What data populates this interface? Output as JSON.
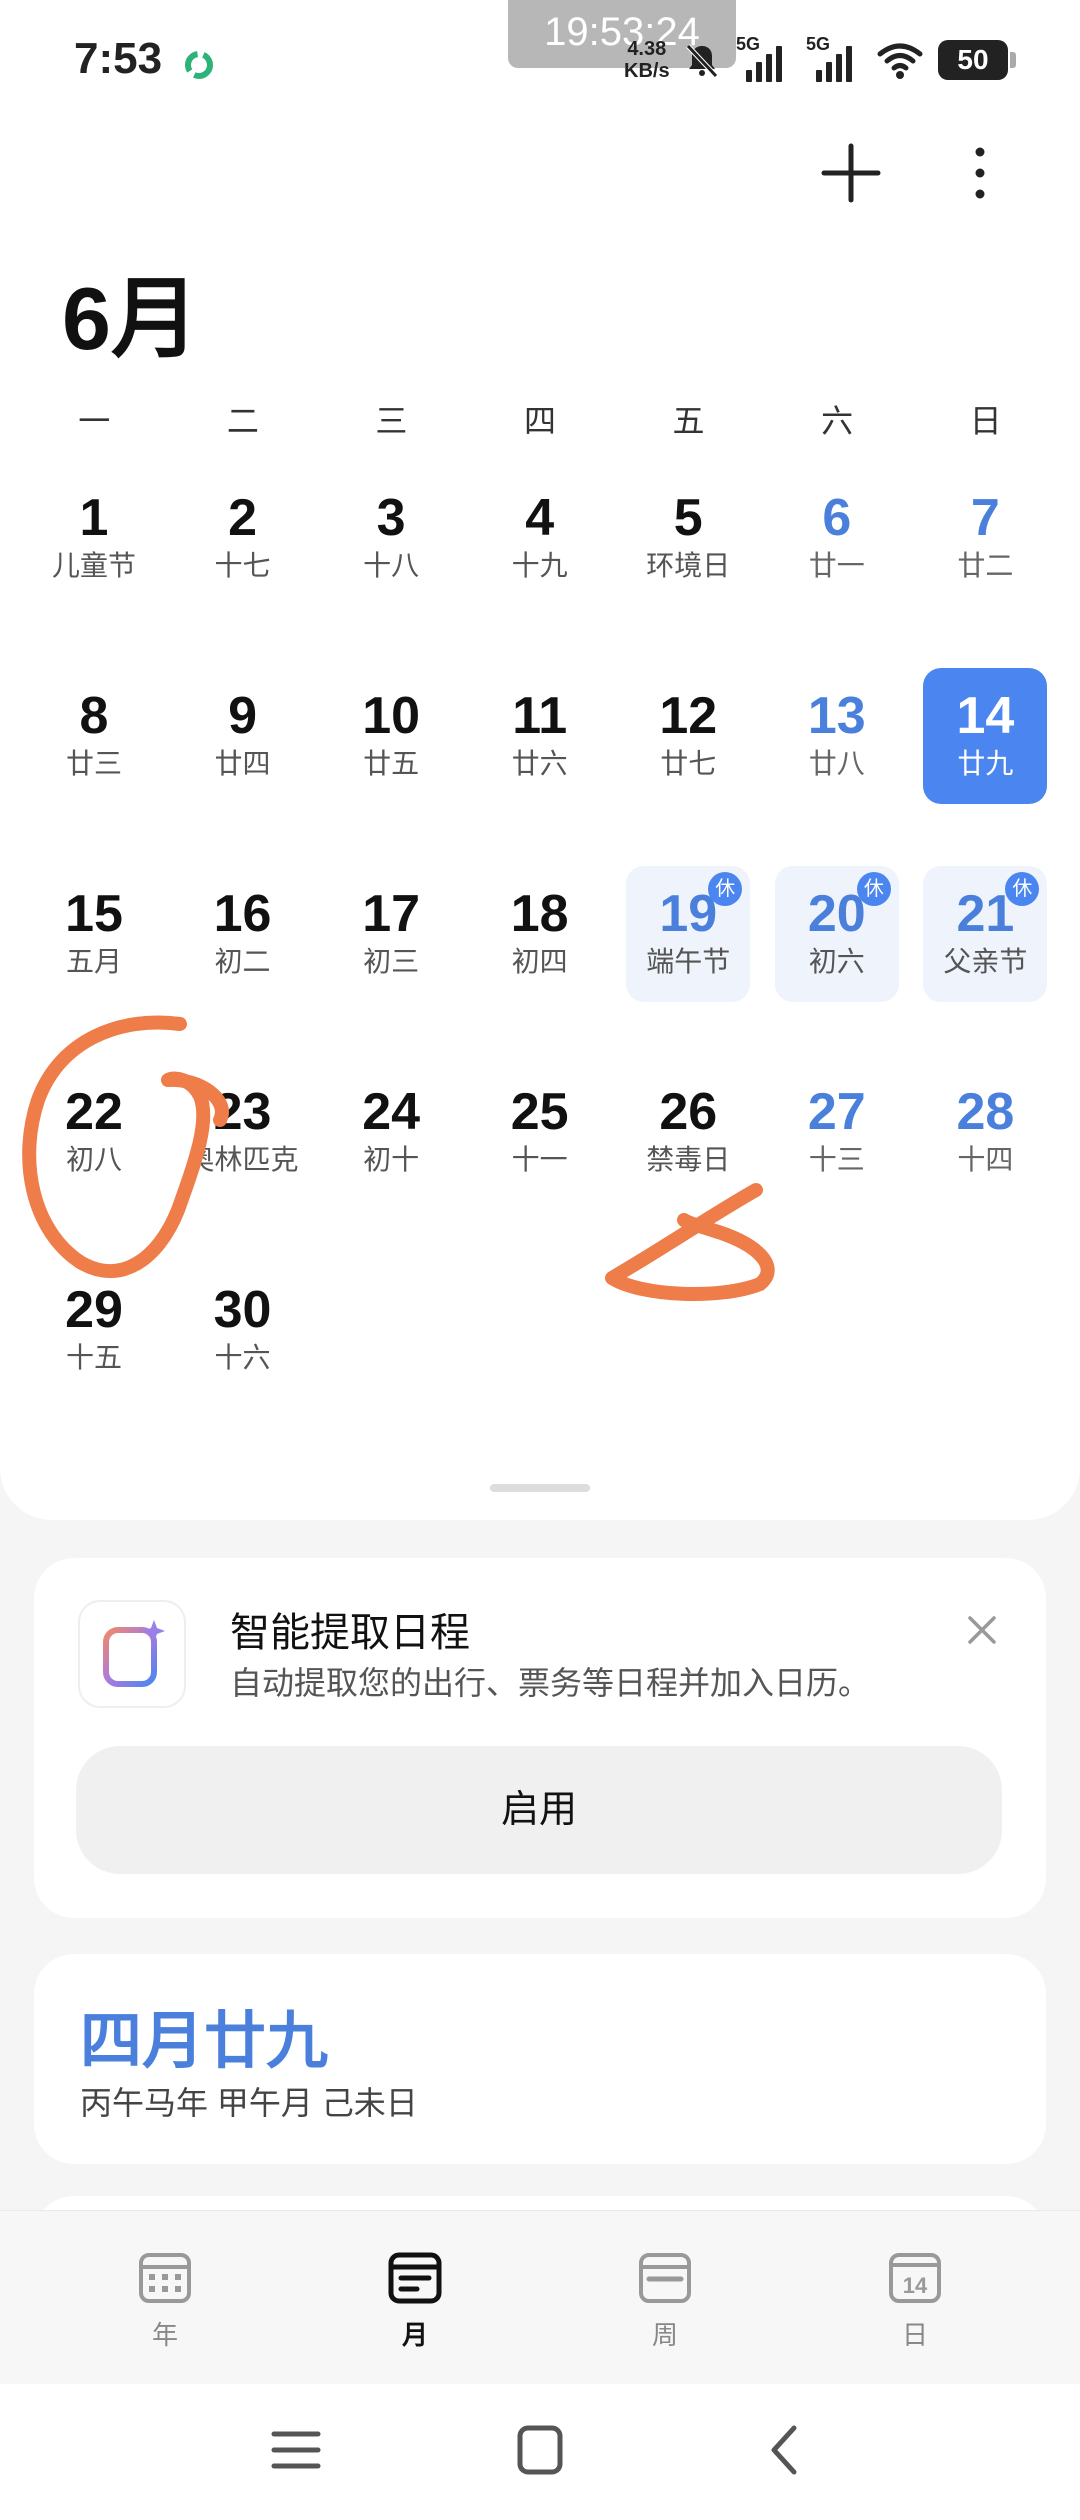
{
  "status_bar": {
    "time": "7:53",
    "overlay_clock": "19:53:24",
    "net_speed_value": "4.38",
    "net_speed_unit": "KB/s",
    "signal_1_label": "5G",
    "signal_2_label": "5G",
    "battery": "50"
  },
  "header": {
    "month_title": "6月"
  },
  "weekdays": [
    "一",
    "二",
    "三",
    "四",
    "五",
    "六",
    "日"
  ],
  "calendar": {
    "days": [
      {
        "num": "1",
        "sub": "儿童节"
      },
      {
        "num": "2",
        "sub": "十七"
      },
      {
        "num": "3",
        "sub": "十八"
      },
      {
        "num": "4",
        "sub": "十九"
      },
      {
        "num": "5",
        "sub": "环境日"
      },
      {
        "num": "6",
        "sub": "廿一"
      },
      {
        "num": "7",
        "sub": "廿二"
      },
      {
        "num": "8",
        "sub": "廿三"
      },
      {
        "num": "9",
        "sub": "廿四"
      },
      {
        "num": "10",
        "sub": "廿五"
      },
      {
        "num": "11",
        "sub": "廿六"
      },
      {
        "num": "12",
        "sub": "廿七"
      },
      {
        "num": "13",
        "sub": "廿八"
      },
      {
        "num": "14",
        "sub": "廿九"
      },
      {
        "num": "15",
        "sub": "五月"
      },
      {
        "num": "16",
        "sub": "初二"
      },
      {
        "num": "17",
        "sub": "初三"
      },
      {
        "num": "18",
        "sub": "初四"
      },
      {
        "num": "19",
        "sub": "端午节"
      },
      {
        "num": "20",
        "sub": "初六"
      },
      {
        "num": "21",
        "sub": "父亲节"
      },
      {
        "num": "22",
        "sub": "初八"
      },
      {
        "num": "23",
        "sub": "奥林匹克"
      },
      {
        "num": "24",
        "sub": "初十"
      },
      {
        "num": "25",
        "sub": "十一"
      },
      {
        "num": "26",
        "sub": "禁毒日"
      },
      {
        "num": "27",
        "sub": "十三"
      },
      {
        "num": "28",
        "sub": "十四"
      },
      {
        "num": "29",
        "sub": "十五"
      },
      {
        "num": "30",
        "sub": "十六"
      }
    ],
    "rest_badge": "休",
    "today": "14"
  },
  "smart_card": {
    "title": "智能提取日程",
    "description": "自动提取您的出行、票务等日程并加入日历。",
    "enable_label": "启用"
  },
  "lunar_card": {
    "lunar_date": "四月廿九",
    "ganzhi": "丙午马年 甲午月 己未日"
  },
  "tabs": [
    {
      "label": "年",
      "icon": "year-grid-icon"
    },
    {
      "label": "月",
      "icon": "month-list-icon"
    },
    {
      "label": "周",
      "icon": "week-icon"
    },
    {
      "label": "日",
      "icon": "day-icon",
      "day_number": "14"
    }
  ],
  "active_tab": "月",
  "colors": {
    "accent": "#4b86f0",
    "weekend_text": "#4a80dc",
    "holiday_bg": "#eef3fc",
    "annotation": "#ee7d4a"
  }
}
